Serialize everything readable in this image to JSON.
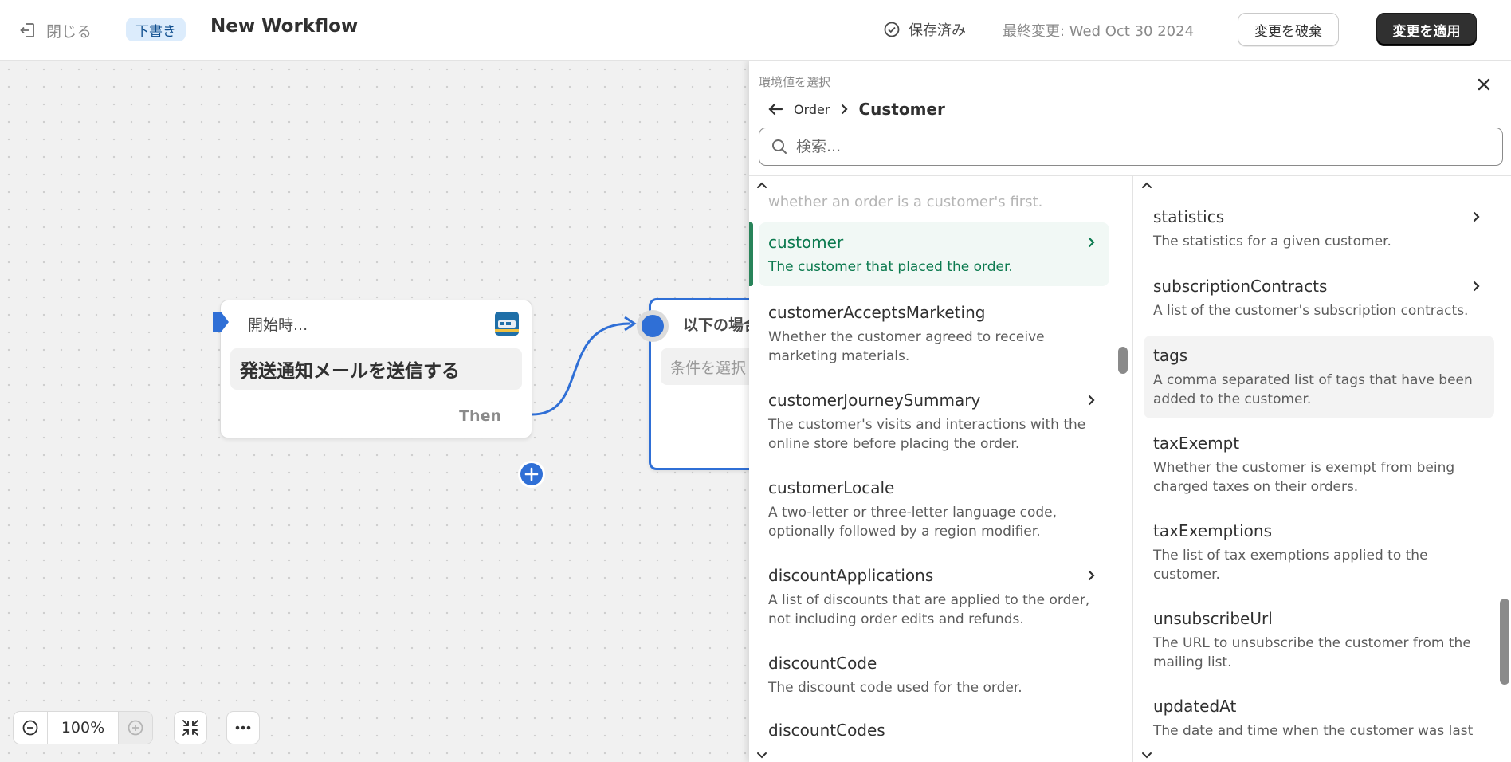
{
  "topbar": {
    "close_label": "閉じる",
    "status_badge": "下書き",
    "workflow_title": "New Workflow",
    "saved_label": "保存済み",
    "last_modified": "最終変更: Wed Oct 30 2024",
    "discard_label": "変更を破棄",
    "apply_label": "変更を適用"
  },
  "canvas": {
    "trigger_node": {
      "header": "開始時...",
      "body": "発送通知メールを送信する",
      "then_label": "Then"
    },
    "condition_node": {
      "header": "以下の場合",
      "placeholder": "条件を選択"
    },
    "zoom_level": "100%"
  },
  "panel": {
    "label": "環境値を選択",
    "breadcrumb_parent": "Order",
    "breadcrumb_current": "Customer",
    "search_placeholder": "検索...",
    "left_column": {
      "faded_text": "whether an order is a customer's first.",
      "items": [
        {
          "name": "customer",
          "desc": "The customer that placed the order.",
          "has_children": true,
          "active": true
        },
        {
          "name": "customerAcceptsMarketing",
          "desc": "Whether the customer agreed to receive marketing materials.",
          "has_children": false
        },
        {
          "name": "customerJourneySummary",
          "desc": "The customer's visits and interactions with the online store before placing the order.",
          "has_children": true
        },
        {
          "name": "customerLocale",
          "desc": "A two-letter or three-letter language code, optionally followed by a region modifier.",
          "has_children": false
        },
        {
          "name": "discountApplications",
          "desc": "A list of discounts that are applied to the order, not including order edits and refunds.",
          "has_children": true
        },
        {
          "name": "discountCode",
          "desc": "The discount code used for the order.",
          "has_children": false
        },
        {
          "name": "discountCodes",
          "desc": "",
          "has_children": false
        }
      ]
    },
    "right_column": {
      "items": [
        {
          "name": "statistics",
          "desc": "The statistics for a given customer.",
          "has_children": true
        },
        {
          "name": "subscriptionContracts",
          "desc": "A list of the customer's subscription contracts.",
          "has_children": true
        },
        {
          "name": "tags",
          "desc": "A comma separated list of tags that have been added to the customer.",
          "has_children": false,
          "hover": true
        },
        {
          "name": "taxExempt",
          "desc": "Whether the customer is exempt from being charged taxes on their orders.",
          "has_children": false
        },
        {
          "name": "taxExemptions",
          "desc": "The list of tax exemptions applied to the customer.",
          "has_children": false
        },
        {
          "name": "unsubscribeUrl",
          "desc": "The URL to unsubscribe the customer from the mailing list.",
          "has_children": false
        },
        {
          "name": "updatedAt",
          "desc": "The date and time when the customer was last",
          "has_children": false
        }
      ]
    }
  },
  "colors": {
    "accent_blue": "#2f6fd6",
    "active_green": "#0c7a4f",
    "primary_dark": "#303030"
  }
}
